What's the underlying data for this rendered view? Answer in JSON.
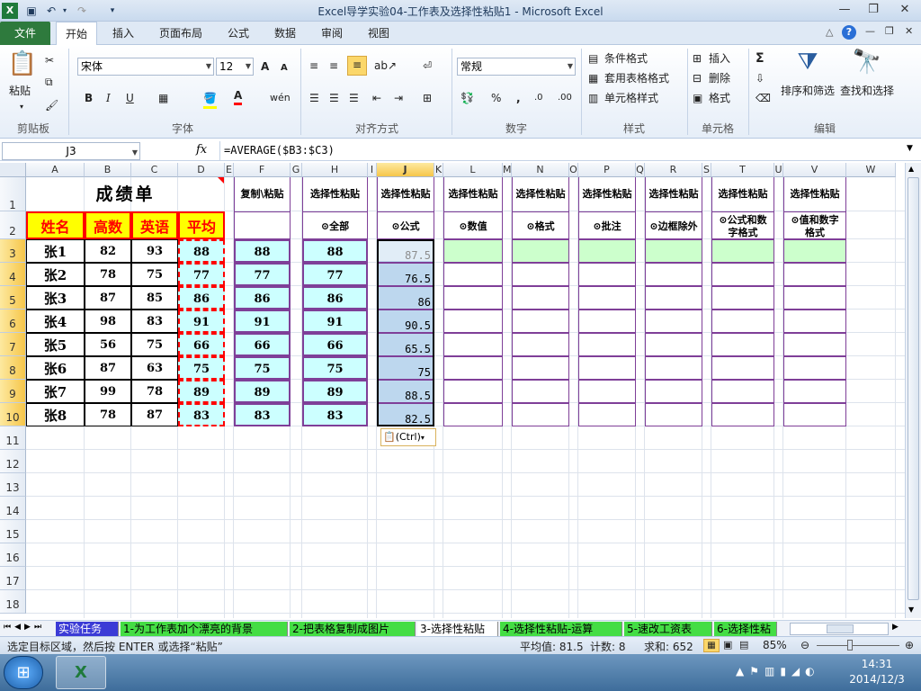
{
  "window": {
    "title": "Excel导学实验04-工作表及选择性粘贴1  -  Microsoft Excel",
    "min_icon": "minimize-icon",
    "max_icon": "restore-icon",
    "close_icon": "close-icon"
  },
  "ribbon_tabs": [
    "文件",
    "开始",
    "插入",
    "页面布局",
    "公式",
    "数据",
    "审阅",
    "视图"
  ],
  "ribbon": {
    "clipboard": {
      "paste": "粘贴",
      "label": "剪贴板"
    },
    "font": {
      "name": "宋体",
      "size": "12",
      "label": "字体",
      "bold": "B",
      "italic": "I",
      "underline": "U",
      "grow": "A",
      "shrink": "A",
      "font_color": "A"
    },
    "alignment": {
      "label": "对齐方式"
    },
    "number": {
      "format": "常规",
      "label": "数字",
      "percent": "%",
      "comma": ",",
      "inc_dec": ".0",
      "dec_dec": ".00"
    },
    "styles": {
      "cond": "条件格式",
      "table": "套用表格格式",
      "cell": "单元格样式",
      "label": "样式"
    },
    "cells": {
      "insert": "插入",
      "delete": "删除",
      "format": "格式",
      "label": "单元格"
    },
    "editing": {
      "sigma": "Σ",
      "sort": "排序和筛选",
      "find": "查找和选择",
      "label": "编辑"
    }
  },
  "formula_bar": {
    "name_box": "J3",
    "fx": "fx",
    "formula": "=AVERAGE($B3:$C3)"
  },
  "columns": [
    "A",
    "B",
    "C",
    "D",
    "E",
    "F",
    "G",
    "H",
    "I",
    "J",
    "K",
    "L",
    "M",
    "N",
    "O",
    "P",
    "Q",
    "R",
    "S",
    "T",
    "U",
    "V",
    "W"
  ],
  "rows": [
    "1",
    "2",
    "3",
    "4",
    "5",
    "6",
    "7",
    "8",
    "9",
    "10",
    "11",
    "12",
    "13",
    "14",
    "15",
    "16",
    "17",
    "18"
  ],
  "table": {
    "title": "成绩单",
    "headers": [
      "姓名",
      "高数",
      "英语",
      "平均"
    ],
    "rows": [
      [
        "张1",
        "82",
        "93",
        "88"
      ],
      [
        "张2",
        "78",
        "75",
        "77"
      ],
      [
        "张3",
        "87",
        "85",
        "86"
      ],
      [
        "张4",
        "98",
        "83",
        "91"
      ],
      [
        "张5",
        "56",
        "75",
        "66"
      ],
      [
        "张6",
        "87",
        "63",
        "75"
      ],
      [
        "张7",
        "99",
        "78",
        "89"
      ],
      [
        "张8",
        "78",
        "87",
        "83"
      ]
    ]
  },
  "paste_cols": {
    "F": {
      "h1": "复制\\粘贴",
      "h2": "",
      "values": [
        "88",
        "77",
        "86",
        "91",
        "66",
        "75",
        "89",
        "83"
      ]
    },
    "H": {
      "h1": "选择性粘贴",
      "h2": "⊙全部",
      "values": [
        "88",
        "77",
        "86",
        "91",
        "66",
        "75",
        "89",
        "83"
      ]
    },
    "J": {
      "h1": "选择性粘贴",
      "h2": "⊙公式",
      "values": [
        "87.5",
        "76.5",
        "86",
        "90.5",
        "65.5",
        "75",
        "88.5",
        "82.5"
      ]
    },
    "L": {
      "h1": "选择性粘贴",
      "h2": "⊙数值"
    },
    "N": {
      "h1": "选择性粘贴",
      "h2": "⊙格式"
    },
    "P": {
      "h1": "选择性粘贴",
      "h2": "⊙批注"
    },
    "R": {
      "h1": "选择性粘贴",
      "h2": "⊙边框除外"
    },
    "T": {
      "h1": "选择性粘贴",
      "h2a": "⊙公式和数",
      "h2b": "字格式"
    },
    "V": {
      "h1": "选择性粘贴",
      "h2a": "⊙值和数字",
      "h2b": "格式"
    }
  },
  "paste_options": "(Ctrl)",
  "sheet_tabs": [
    "实验任务",
    "1-为工作表加个漂亮的背景",
    "2-把表格复制成图片",
    "3-选择性粘贴",
    "4-选择性粘贴-运算",
    "5-速改工资表",
    "6-选择性粘"
  ],
  "status": {
    "message": "选定目标区域，然后按 ENTER 或选择“粘贴”",
    "average": "平均值: 81.5",
    "count": "计数: 8",
    "sum": "求和: 652",
    "zoom": "85%"
  },
  "taskbar": {
    "time": "14:31",
    "date": "2014/12/3"
  },
  "colors": {
    "header_bg": "#ffff00",
    "header_text": "#ff0000",
    "border_red": "#ff0000",
    "cyan_fill": "#ccffff",
    "green_fill": "#ccffcc",
    "blue_sel": "#bdd7ee",
    "purple_border": "#7f3f98",
    "file_tab": "#2e7a3d"
  }
}
